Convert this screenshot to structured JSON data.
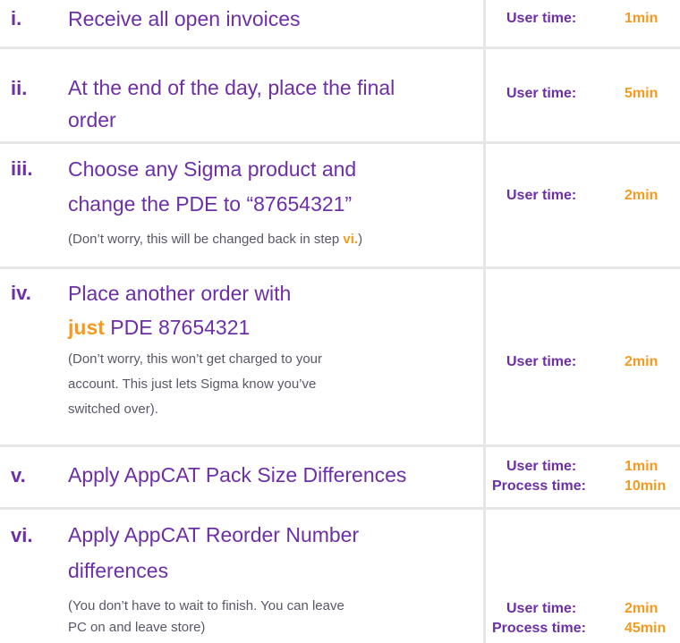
{
  "accent_color": "#f59a1e",
  "primary_color": "#6d2fa6",
  "steps": [
    {
      "numeral": "i.",
      "text": "Receive all open invoices",
      "times": [
        {
          "label": "User time:",
          "value": "1min"
        }
      ]
    },
    {
      "numeral": "ii.",
      "text_line1": "At the end of the day, place the final",
      "text_line2": "order",
      "times": [
        {
          "label": "User time:",
          "value": "5min"
        }
      ]
    },
    {
      "numeral": "iii.",
      "text_line1": "Choose any Sigma product and",
      "text_line2": "change the PDE to “87654321”",
      "note_before": "(Don’t worry, this will be changed back in step ",
      "note_ref": "vi.",
      "note_after": ")",
      "times": [
        {
          "label": "User time:",
          "value": "2min"
        }
      ]
    },
    {
      "numeral": "iv.",
      "text_line1": "Place another order with",
      "emphasis": "just",
      "text_line2_rest": " PDE 87654321",
      "note_line1": "(Don’t worry, this won’t get charged to your",
      "note_line2": "account. This just lets Sigma know you’ve",
      "note_line3": "switched over).",
      "times": [
        {
          "label": "User time:",
          "value": "2min"
        }
      ]
    },
    {
      "numeral": "v.",
      "text": "Apply AppCAT Pack Size Differences",
      "times": [
        {
          "label": "User time:",
          "value": "1min"
        },
        {
          "label": "Process time:",
          "value": "10min"
        }
      ]
    },
    {
      "numeral": "vi.",
      "text_line1": "Apply AppCAT Reorder Number",
      "text_line2": "differences",
      "note_line1": "(You don’t have to wait to finish. You can leave",
      "note_line2": "PC on and leave store)",
      "times": [
        {
          "label": "User time:",
          "value": "2min"
        },
        {
          "label": "Process time:",
          "value": "45min"
        }
      ]
    }
  ]
}
